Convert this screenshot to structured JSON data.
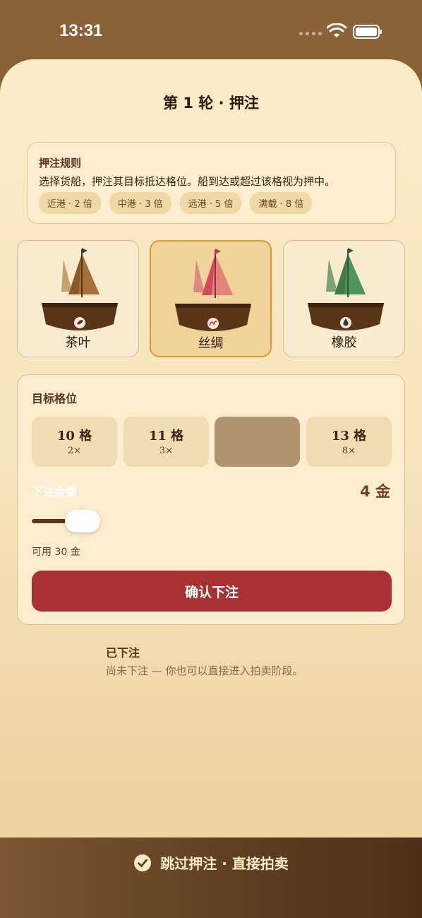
{
  "status": {
    "time": "13:31"
  },
  "title": "第 1 轮 · 押注",
  "rules": {
    "title": "押注规则",
    "text": "选择货船，押注其目标抵达格位。船到达或超过该格视为押中。",
    "chips": [
      "近港 · 2 倍",
      "中港 · 3 倍",
      "远港 · 5 倍",
      "满载 · 8 倍"
    ]
  },
  "ships": [
    {
      "label": "茶叶",
      "selected": false,
      "color": "#8b5a2b",
      "icon": "leaf-icon"
    },
    {
      "label": "丝绸",
      "selected": true,
      "color": "#d44a5a",
      "icon": "silk-icon"
    },
    {
      "label": "橡胶",
      "selected": false,
      "color": "#3f7a4b",
      "icon": "droplet-icon"
    }
  ],
  "target": {
    "label": "目标格位",
    "slots": [
      {
        "name": "10 格",
        "mult": "2×",
        "active": false
      },
      {
        "name": "11 格",
        "mult": "3×",
        "active": false
      },
      {
        "name": "",
        "mult": "",
        "active": true
      },
      {
        "name": "13 格",
        "mult": "8×",
        "active": false
      }
    ],
    "bet_label": "下注金额",
    "bet_amount": "4 金",
    "available": "可用 30 金",
    "confirm": "确认下注"
  },
  "placed": {
    "title": "已下注",
    "text": "尚未下注 — 你也可以直接进入拍卖阶段。"
  },
  "footer": {
    "label": "跳过押注 · 直接拍卖"
  },
  "colors": {
    "accent": "#a93131",
    "brown": "#5a3518",
    "selected_border": "#d99a36"
  }
}
